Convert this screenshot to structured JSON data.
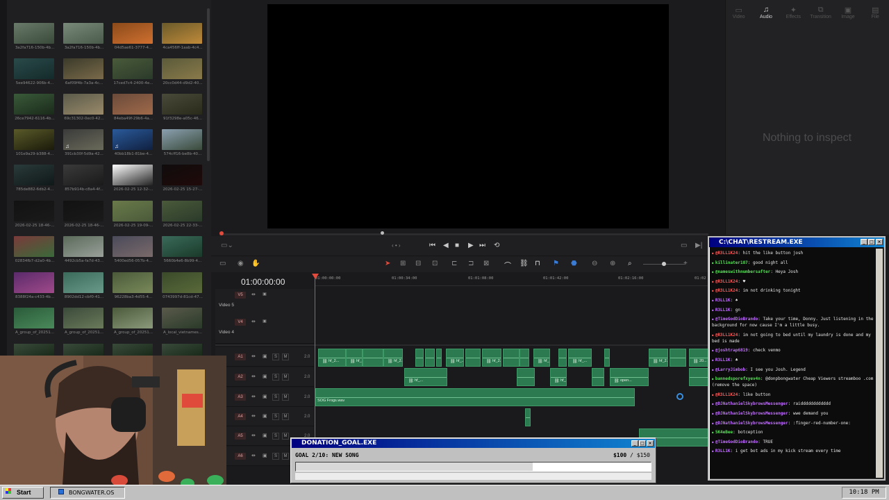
{
  "media_pool": {
    "clips": [
      "3a2fa716-150b-4b...",
      "3a2fa716-150b-4b...",
      "04d5ae61-3777-4...",
      "4ca456ff-1aab-4c4...",
      "5ee94622-906b-4...",
      "6af09f4b-7a3a-4c...",
      "17ced7c4-2400-4e...",
      "20cc0d44-d9d2-40...",
      "26ce7942-6116-4b...",
      "69c31302-0ec0-42...",
      "84eba49f-29b6-4a...",
      "91f3298e-a05c-46...",
      "101e9a29-b388-4...",
      "391cb30f-5d9a-42...",
      "40bb18b1-81be-4...",
      "574cff16-be8b-40...",
      "785de882-6db2-4...",
      "857b914b-c8a4-4f...",
      "2026-02-25 12-32-...",
      "2026-02-25 15-27-...",
      "2026-02-25 18-46-...",
      "2026-02-25 18-46-...",
      "2026-02-25 19-09-...",
      "2026-02-25 22-33-...",
      "02834fb7-d2a0-4b...",
      "4492cb5a-fa7d-43...",
      "5400ed56-057b-4...",
      "5660b4e6-8b99-4...",
      "8388f24a-c433-4b...",
      "8902dd12-cbf0-41...",
      "96228ba3-4d55-4...",
      "0743997d-81cd-47...",
      "A_group_of_20251...",
      "A_group_of_20251...",
      "A_group_of_20251...",
      "A_local_vietnames..."
    ]
  },
  "inspector": {
    "tabs": [
      "Video",
      "Audio",
      "Effects",
      "Transition",
      "Image",
      "File"
    ],
    "active_tab": "Audio",
    "empty_message": "Nothing to inspect"
  },
  "timeline": {
    "timecode": "01:00:00:00",
    "ruler": [
      "01:00:00:00",
      "01:00:34:00",
      "01:01:08:00",
      "01:01:42:00",
      "01:02:16:00",
      "01:02"
    ],
    "tracks": [
      {
        "id": "V5",
        "name": "Video 5"
      },
      {
        "id": "V4",
        "name": "Video 4"
      },
      {
        "id": "A1",
        "vol": "2.0"
      },
      {
        "id": "A2",
        "vol": "2.0"
      },
      {
        "id": "A3",
        "vol": "2.0"
      },
      {
        "id": "A4",
        "vol": "2.0"
      },
      {
        "id": "A5",
        "vol": "2.0"
      },
      {
        "id": "A6",
        "vol": "2.0"
      }
    ],
    "clip_labels": {
      "a": "hf_2...",
      "b": "hf_20...",
      "c": "hf_2...",
      "d": "hf_...",
      "e": "hf_2...",
      "f": "hf_2...",
      "g": "hf_...",
      "h": "open...",
      "frogs": "SOG Frogs.wav",
      "i": "20..."
    },
    "track_buttons": {
      "solo": "S",
      "mute": "M"
    }
  },
  "chat": {
    "title": "C:\\CHAT\\RESTREAM.EXE",
    "messages": [
      {
        "user": "@R3LL1K24",
        "color": "#ff5a5a",
        "text": "hit the like button josh"
      },
      {
        "user": "killinater187",
        "color": "#5ae05a",
        "text": "good night all"
      },
      {
        "user": "@nameswithnumbersafter",
        "color": "#5ae05a",
        "text": "Heya Josh"
      },
      {
        "user": "@R3LL1K24",
        "color": "#ff5a5a",
        "text": "♥"
      },
      {
        "user": "@R3LL1K24",
        "color": "#ff5a5a",
        "text": "im not drinking tonight"
      },
      {
        "user": "R3LL1K",
        "color": "#c26fff",
        "text": "♠"
      },
      {
        "user": "R3LL1K",
        "color": "#c26fff",
        "text": "gn"
      },
      {
        "user": "@TimeGodDioBrando",
        "color": "#c26fff",
        "text": "Take your time, Donny. Just listening in the background for now cause I'm a little busy."
      },
      {
        "user": "@R3LL1K24",
        "color": "#ff5a5a",
        "text": "im not going to bed until my laundry is done and my bed is made"
      },
      {
        "user": "@joshtrap6819",
        "color": "#c26fff",
        "text": "check venmo"
      },
      {
        "user": "R3LL1K",
        "color": "#c26fff",
        "text": "♣"
      },
      {
        "user": "@LarryJimbob",
        "color": "#c26fff",
        "text": "I see you Josh. Legend"
      },
      {
        "user": "bannedsporefxyev4n",
        "color": "#5ae05a",
        "text": "@donpbongwater Cheap Viewers streamboo .com (remove the space)"
      },
      {
        "user": "@R3LL1K24",
        "color": "#ff5a5a",
        "text": "like button"
      },
      {
        "user": "@DJNathanielSkybrowsMessenger",
        "color": "#c26fff",
        "text": "raidddddddddddd"
      },
      {
        "user": "@DJNathanielSkybrowsMessenger",
        "color": "#c26fff",
        "text": "wwe demand you"
      },
      {
        "user": "@DJNathanielSkybrowsMessenger",
        "color": "#c26fff",
        "text": ":finger-red-number-one:"
      },
      {
        "user": "5K4eBee",
        "color": "#5ae05a",
        "text": "botception"
      },
      {
        "user": "@TimeGodDioBrando",
        "color": "#c26fff",
        "text": "TRUE"
      },
      {
        "user": "R3LL1K",
        "color": "#c26fff",
        "text": "i get bot ads in my kick stream every time"
      }
    ]
  },
  "donation": {
    "title": "DONATION_GOAL.EXE",
    "goal": "GOAL 2/10: NEW SONG",
    "current": "$100",
    "separator": "/",
    "target": "$150",
    "progress": 0.667
  },
  "taskbar": {
    "start": "Start",
    "task": "BONGWATER.OS",
    "clock": "10:18 PM"
  },
  "colors": {
    "clip_green": "#2c7a4f",
    "playhead": "#e24a3b",
    "titlebar": "#000080"
  }
}
